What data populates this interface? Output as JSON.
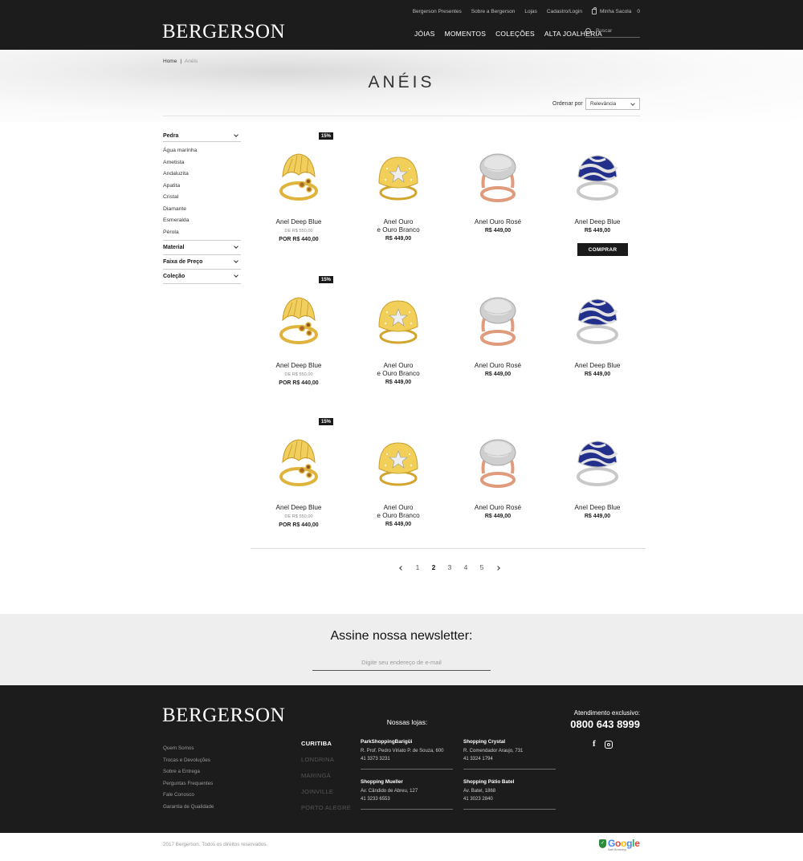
{
  "header": {
    "logo": "BERGERSON",
    "top_links": [
      "Bergerson Presentes",
      "Sobre a Bergerson",
      "Lojas",
      "Cadastro/Login"
    ],
    "bag_label": "Minha Sacola",
    "bag_count": "0",
    "nav": [
      "JÓIAS",
      "MOMENTOS",
      "COLEÇÕES",
      "ALTA JOALHERIA"
    ],
    "search_placeholder": "Buscar"
  },
  "breadcrumb": {
    "home": "Home",
    "separator": "|",
    "current": "Anéis"
  },
  "page_title": "ANÉIS",
  "sort": {
    "label": "Ordenar por",
    "selected": "Relevância"
  },
  "filters": {
    "pedra": {
      "title": "Pedra",
      "options": [
        "Água marinha",
        "Ametista",
        "Andaluzita",
        "Apatita",
        "Cristal",
        "Diamante",
        "Esmeralda",
        "Pérola"
      ]
    },
    "groups": [
      "Material",
      "Faixa de Preço",
      "Coleção"
    ]
  },
  "products": [
    {
      "name1": "Anel Deep Blue",
      "name2": "",
      "old": "DE R$ 550,00",
      "price": "POR R$ 440,00",
      "badge": "15%",
      "type": "gold-shell"
    },
    {
      "name1": "Anel Ouro",
      "name2": "e Ouro Branco",
      "old": "",
      "price": "R$ 449,00",
      "badge": "",
      "type": "gold-dome"
    },
    {
      "name1": "Anel Ouro Rosé",
      "name2": "",
      "old": "",
      "price": "R$ 449,00",
      "badge": "",
      "type": "rose-pave"
    },
    {
      "name1": "Anel Deep Blue",
      "name2": "",
      "old": "",
      "price": "R$ 449,00",
      "badge": "",
      "type": "blue-sapphire",
      "buy": "COMPRAR"
    },
    {
      "name1": "Anel Deep Blue",
      "name2": "",
      "old": "DE R$ 550,00",
      "price": "POR R$ 440,00",
      "badge": "15%",
      "type": "gold-shell"
    },
    {
      "name1": "Anel Ouro",
      "name2": "e Ouro Branco",
      "old": "",
      "price": "R$ 449,00",
      "badge": "",
      "type": "gold-dome"
    },
    {
      "name1": "Anel Ouro Rosé",
      "name2": "",
      "old": "",
      "price": "R$ 449,00",
      "badge": "",
      "type": "rose-pave"
    },
    {
      "name1": "Anel Deep Blue",
      "name2": "",
      "old": "",
      "price": "R$ 449,00",
      "badge": "",
      "type": "blue-sapphire"
    },
    {
      "name1": "Anel Deep Blue",
      "name2": "",
      "old": "DE R$ 550,00",
      "price": "POR R$ 440,00",
      "badge": "15%",
      "type": "gold-shell"
    },
    {
      "name1": "Anel Ouro",
      "name2": "e Ouro Branco",
      "old": "",
      "price": "R$ 449,00",
      "badge": "",
      "type": "gold-dome"
    },
    {
      "name1": "Anel Ouro Rosé",
      "name2": "",
      "old": "",
      "price": "R$ 449,00",
      "badge": "",
      "type": "rose-pave"
    },
    {
      "name1": "Anel Deep Blue",
      "name2": "",
      "old": "",
      "price": "R$ 449,00",
      "badge": "",
      "type": "blue-sapphire"
    }
  ],
  "pagination": {
    "pages": [
      "1",
      "2",
      "3",
      "4",
      "5"
    ],
    "current": "2"
  },
  "newsletter": {
    "title": "Assine nossa newsletter:",
    "placeholder": "Digite seu endereço de e-mail"
  },
  "footer": {
    "logo": "BERGERSON",
    "links": [
      "Quem Somos",
      "Trocas e Devoluções",
      "Sobre a Entrega",
      "Perguntas Frequentes",
      "Fale Conosco",
      "Garantia de Qualidade"
    ],
    "stores_title": "Nossas lojas:",
    "cities": [
      "CURITIBA",
      "LONDRINA",
      "MARINGÁ",
      "JOINVILLE",
      "PORTO ALEGRE"
    ],
    "selected_city": "CURITIBA",
    "stores": [
      {
        "name": "ParkShoppingBarigüi",
        "address": "R. Prof. Pedro Viriato P. de Souza, 600",
        "phone": "41 3373 3231"
      },
      {
        "name": "Shopping Crystal",
        "address": "R. Comendador Araujo, 731",
        "phone": "41 3324 1794"
      },
      {
        "name": "Shopping Mueller",
        "address": "Av. Cândido de Abreu, 127",
        "phone": "41 3233 6553"
      },
      {
        "name": "Shopping Pátio Batel",
        "address": "Av. Batel, 1868",
        "phone": "41 3023 2840"
      }
    ],
    "attendance_label": "Atendimento exclusivo:",
    "phone": "0800 643 8999",
    "copyright": "2017 Bergerson. Todos os direitos reservados.",
    "google_badge": "Google",
    "google_sub": "Safe Browsing"
  },
  "colors": {
    "dark": "#1c1c1c",
    "gold": "#e8c04a",
    "rose": "#e0a085",
    "sapphire": "#1e2a8a",
    "google_shield": "#2e8b3c"
  }
}
